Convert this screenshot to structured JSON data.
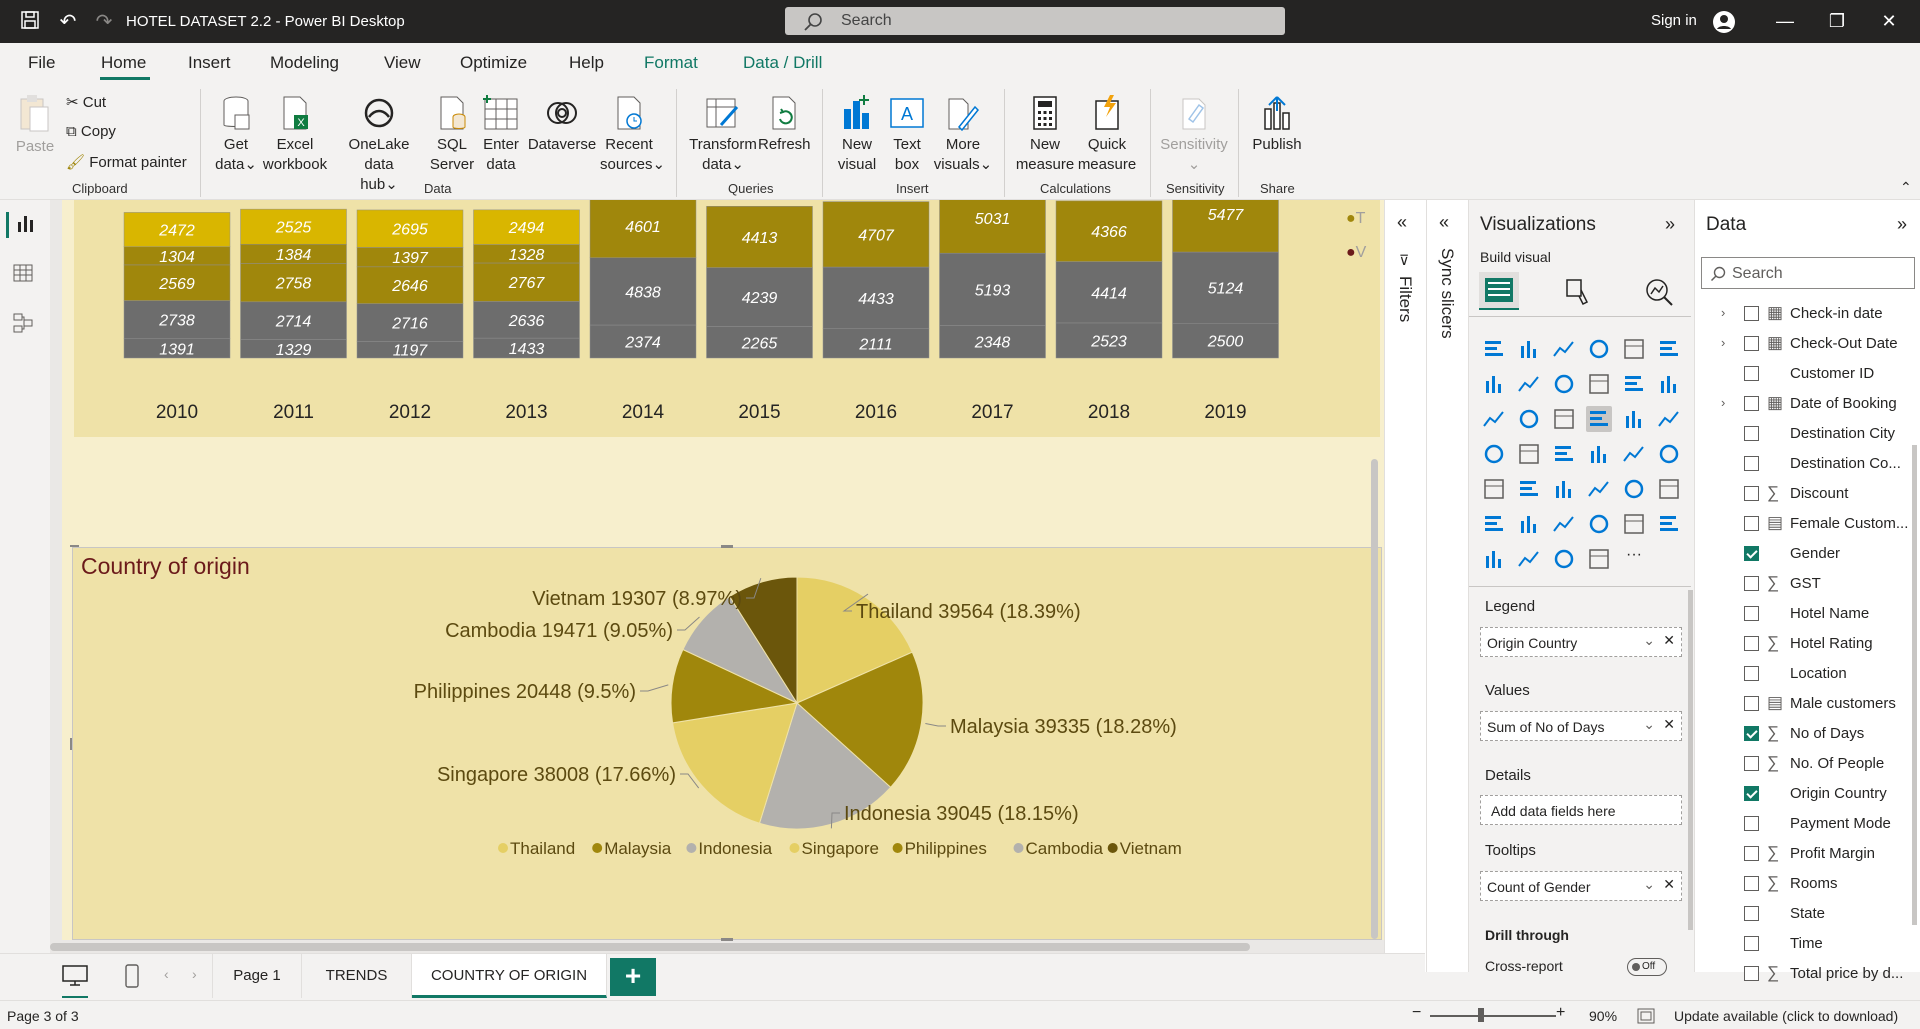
{
  "window": {
    "title": "HOTEL DATASET 2.2 - Power BI Desktop",
    "search_placeholder": "Search",
    "sign_in": "Sign in"
  },
  "menu": {
    "tabs": [
      "File",
      "Home",
      "Insert",
      "Modeling",
      "View",
      "Optimize",
      "Help",
      "Format",
      "Data / Drill"
    ]
  },
  "ribbon": {
    "clipboard": {
      "paste": "Paste",
      "cut": "Cut",
      "copy": "Copy",
      "format_painter": "Format painter",
      "group": "Clipboard"
    },
    "data": {
      "get_data": "Get",
      "get_data2": "data",
      "excel": "Excel",
      "excel2": "workbook",
      "onelake": "OneLake data",
      "onelake2": "hub",
      "sql": "SQL",
      "sql2": "Server",
      "enter": "Enter",
      "enter2": "data",
      "dataverse": "Dataverse",
      "recent": "Recent",
      "recent2": "sources",
      "group": "Data"
    },
    "queries": {
      "transform": "Transform",
      "transform2": "data",
      "refresh": "Refresh",
      "group": "Queries"
    },
    "insert": {
      "new_visual": "New",
      "new_visual2": "visual",
      "text_box": "Text",
      "text_box2": "box",
      "more_visuals": "More",
      "more_visuals2": "visuals",
      "group": "Insert"
    },
    "calculations": {
      "new_measure": "New",
      "new_measure2": "measure",
      "quick_measure": "Quick",
      "quick_measure2": "measure",
      "group": "Calculations"
    },
    "sensitivity": {
      "label": "Sensitivity",
      "group": "Sensitivity"
    },
    "share": {
      "publish": "Publish",
      "group": "Share"
    }
  },
  "bar_chart": {
    "years": [
      "2010",
      "2011",
      "2012",
      "2013",
      "2014",
      "2015",
      "2016",
      "2017",
      "2018",
      "2019"
    ],
    "segments": [
      [
        "2472",
        "1304",
        "2569",
        "2738",
        "1391"
      ],
      [
        "2525",
        "1384",
        "2758",
        "2714",
        "1329"
      ],
      [
        "2695",
        "1397",
        "2646",
        "2716",
        "1197"
      ],
      [
        "2494",
        "1328",
        "2767",
        "2636",
        "1433"
      ],
      [
        "4601",
        "4838",
        "2374"
      ],
      [
        "4413",
        "4239",
        "2265"
      ],
      [
        "4707",
        "4433",
        "2111"
      ],
      [
        "5031",
        "5193",
        "2348"
      ],
      [
        "4366",
        "4414",
        "2523"
      ],
      [
        "5477",
        "5124",
        "2500"
      ]
    ],
    "legend_partial": [
      "T",
      "V"
    ]
  },
  "chart_data": {
    "type": "pie",
    "title": "Country of origin",
    "categories": [
      "Thailand",
      "Malaysia",
      "Indonesia",
      "Singapore",
      "Philippines",
      "Cambodia",
      "Vietnam"
    ],
    "values": [
      39564,
      39335,
      39045,
      38008,
      20448,
      19471,
      19307
    ],
    "labels": [
      "Thailand 39564 (18.39%)",
      "Malaysia 39335 (18.28%)",
      "Indonesia 39045 (18.15%)",
      "Singapore 38008 (17.66%)",
      "Philippines 20448 (9.5%)",
      "Cambodia 19471 (9.05%)",
      "Vietnam 19307 (8.97%)"
    ],
    "colors": [
      "#e5cf64",
      "#a0870c",
      "#b3b1ad",
      "#e5cf64",
      "#a0870c",
      "#b3b1ad",
      "#6b560b"
    ],
    "legend": "bottom"
  },
  "panes": {
    "filters": "Filters",
    "sync_slicers": "Sync slicers"
  },
  "visualizations": {
    "title": "Visualizations",
    "build_visual": "Build visual",
    "legend_label": "Legend",
    "legend_field": "Origin Country",
    "values_label": "Values",
    "values_field": "Sum of No of Days",
    "details_label": "Details",
    "details_placeholder": "Add data fields here",
    "tooltips_label": "Tooltips",
    "tooltips_field": "Count of Gender",
    "drill_label": "Drill through",
    "cross_report": "Cross-report",
    "toggle": "Off"
  },
  "data_pane": {
    "title": "Data",
    "search_placeholder": "Search",
    "fields": [
      {
        "name": "Check-in date",
        "type": "date",
        "expand": true,
        "checked": false
      },
      {
        "name": "Check-Out Date",
        "type": "date",
        "expand": true,
        "checked": false
      },
      {
        "name": "Customer ID",
        "type": "text",
        "expand": false,
        "checked": false
      },
      {
        "name": "Date of Booking",
        "type": "date",
        "expand": true,
        "checked": false
      },
      {
        "name": "Destination City",
        "type": "text",
        "expand": false,
        "checked": false
      },
      {
        "name": "Destination Co...",
        "type": "text",
        "expand": false,
        "checked": false
      },
      {
        "name": "Discount",
        "type": "sum",
        "expand": false,
        "checked": false
      },
      {
        "name": "Female Custom...",
        "type": "calc",
        "expand": false,
        "checked": false
      },
      {
        "name": "Gender",
        "type": "text",
        "expand": false,
        "checked": true
      },
      {
        "name": "GST",
        "type": "sum",
        "expand": false,
        "checked": false
      },
      {
        "name": "Hotel Name",
        "type": "text",
        "expand": false,
        "checked": false
      },
      {
        "name": "Hotel Rating",
        "type": "sum",
        "expand": false,
        "checked": false
      },
      {
        "name": "Location",
        "type": "text",
        "expand": false,
        "checked": false
      },
      {
        "name": "Male customers",
        "type": "calc",
        "expand": false,
        "checked": false
      },
      {
        "name": "No of Days",
        "type": "sum",
        "expand": false,
        "checked": true
      },
      {
        "name": "No. Of People",
        "type": "sum",
        "expand": false,
        "checked": false
      },
      {
        "name": "Origin Country",
        "type": "text",
        "expand": false,
        "checked": true
      },
      {
        "name": "Payment Mode",
        "type": "text",
        "expand": false,
        "checked": false
      },
      {
        "name": "Profit Margin",
        "type": "sum",
        "expand": false,
        "checked": false
      },
      {
        "name": "Rooms",
        "type": "sum",
        "expand": false,
        "checked": false
      },
      {
        "name": "State",
        "type": "text",
        "expand": false,
        "checked": false
      },
      {
        "name": "Time",
        "type": "text",
        "expand": false,
        "checked": false
      },
      {
        "name": "Total price by d...",
        "type": "sum",
        "expand": false,
        "checked": false
      }
    ]
  },
  "pages": {
    "tabs": [
      "Page 1",
      "TRENDS",
      "COUNTRY OF ORIGIN"
    ],
    "active": 2
  },
  "status": {
    "page": "Page 3 of 3",
    "zoom": "90%",
    "update": "Update available (click to download)"
  }
}
